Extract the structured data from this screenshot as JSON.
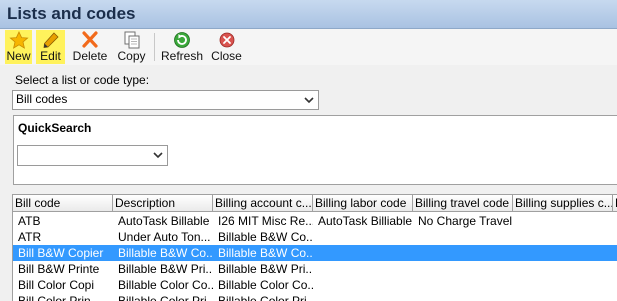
{
  "window": {
    "title": "Lists and codes"
  },
  "toolbar": {
    "buttons": [
      {
        "label": "New",
        "icon": "star-icon"
      },
      {
        "label": "Edit",
        "icon": "pencil-icon"
      },
      {
        "label": "Delete",
        "icon": "delete-x-icon"
      },
      {
        "label": "Copy",
        "icon": "copy-icon"
      },
      {
        "label": "Refresh",
        "icon": "refresh-icon"
      },
      {
        "label": "Close",
        "icon": "close-icon"
      }
    ],
    "highlight_color": "#fff25c"
  },
  "list_type": {
    "label": "Select a list or code type:",
    "selected": "Bill codes"
  },
  "quicksearch": {
    "title": "QuickSearch",
    "selected": ""
  },
  "grid": {
    "columns": [
      "Bill code",
      "Description",
      "Billing account c...",
      "Billing labor code",
      "Billing travel code",
      "Billing supplies c...",
      "B"
    ],
    "rows": [
      {
        "cells": [
          "ATB",
          "AutoTask Billable",
          "I26 MIT Misc Re...",
          "AutoTask Billiable",
          "No Charge Travel",
          ""
        ],
        "selected": false
      },
      {
        "cells": [
          "ATR",
          "Under Auto Ton...",
          "Billable B&W Co...",
          "",
          "",
          ""
        ],
        "selected": false
      },
      {
        "cells": [
          "Bill B&W Copier",
          "Billable B&W Co...",
          "Billable B&W Co...",
          "",
          "",
          ""
        ],
        "selected": true
      },
      {
        "cells": [
          "Bill B&W Printe",
          "Billable B&W Pri...",
          "Billable B&W Pri...",
          "",
          "",
          ""
        ],
        "selected": false
      },
      {
        "cells": [
          "Bill Color Copi",
          "Billable Color Co...",
          "Billable Color Co...",
          "",
          "",
          ""
        ],
        "selected": false
      },
      {
        "cells": [
          "Bill Color Prin",
          "Billable Color Pri...",
          "Billable Color Pri...",
          "",
          "",
          ""
        ],
        "selected": false
      }
    ],
    "selection_color": "#3399ff"
  }
}
